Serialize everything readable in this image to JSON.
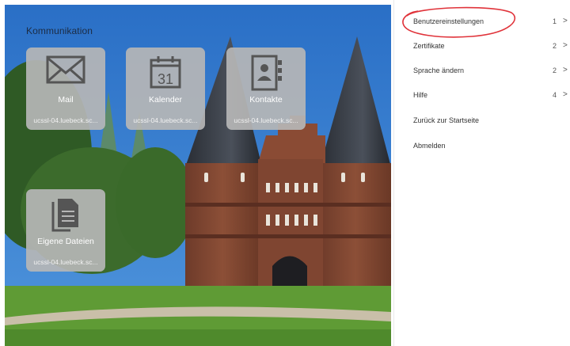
{
  "portal": {
    "section_title": "Kommunikation",
    "tiles": [
      {
        "label": "Mail",
        "host": "ucssl-04.luebeck.sc...",
        "icon": "mail-icon"
      },
      {
        "label": "Kalender",
        "host": "ucssl-04.luebeck.sc...",
        "icon": "calendar-icon",
        "icon_text": "31"
      },
      {
        "label": "Kontakte",
        "host": "ucssl-04.luebeck.sc...",
        "icon": "address-book-icon"
      },
      {
        "label": "Eigene Dateien",
        "host": "ucssl-04.luebeck.sc...",
        "icon": "files-icon"
      }
    ]
  },
  "menu": {
    "items": [
      {
        "label": "Benutzereinstellungen",
        "count": "1",
        "chevron": ">"
      },
      {
        "label": "Zertifikate",
        "count": "2",
        "chevron": ">"
      },
      {
        "label": "Sprache ändern",
        "count": "2",
        "chevron": ">"
      },
      {
        "label": "Hilfe",
        "count": "4",
        "chevron": ">"
      },
      {
        "label": "Zurück zur Startseite"
      },
      {
        "label": "Abmelden"
      }
    ]
  },
  "colors": {
    "tile_bg": "#b6b6b6",
    "annotation": "#e0333a",
    "sky": "#2f78cc"
  }
}
